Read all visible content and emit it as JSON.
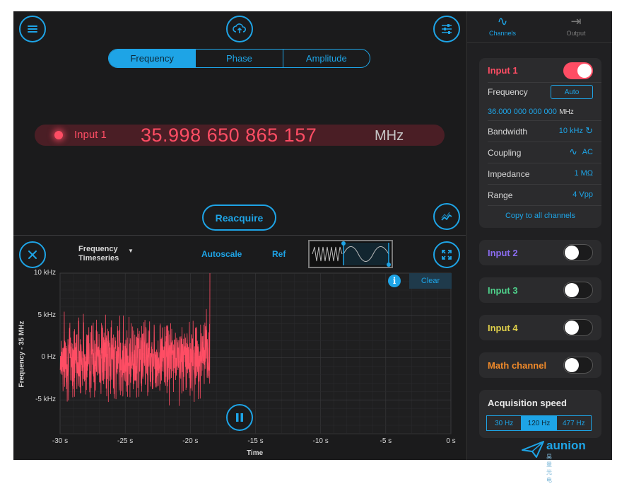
{
  "top": {
    "tabs": [
      {
        "label": "Frequency",
        "active": true
      },
      {
        "label": "Phase",
        "active": false
      },
      {
        "label": "Amplitude",
        "active": false
      }
    ],
    "readout": {
      "channel": "Input 1",
      "value": "35.998 650 865 157",
      "unit": "MHz"
    },
    "reacquire_label": "Reacquire"
  },
  "plot": {
    "mode_line1": "Frequency",
    "mode_line2": "Timeseries",
    "autoscale_label": "Autoscale",
    "ref_label": "Ref",
    "clear_label": "Clear",
    "info_label": "i"
  },
  "chart_data": {
    "type": "line",
    "xlabel": "Time",
    "ylabel": "Frequency - 35 MHz",
    "x_ticks": [
      "-30 s",
      "-25 s",
      "-20 s",
      "-15 s",
      "-10 s",
      "-5 s",
      "0 s"
    ],
    "y_ticks": [
      "10 kHz",
      "5 kHz",
      "0 Hz",
      "-5 kHz"
    ],
    "xlim": [
      -30,
      0
    ],
    "ylim": [
      -9,
      10
    ],
    "x_unit": "s",
    "y_unit": "kHz",
    "series": [
      {
        "color": "#ff4d64",
        "x_range": [
          -30,
          -18.5
        ],
        "mean": 0,
        "spread": 6.5
      }
    ],
    "grid": true
  },
  "sidebar": {
    "tabs": [
      {
        "label": "Channels",
        "icon": "sine-wave-icon",
        "active": true
      },
      {
        "label": "Output",
        "icon": "output-icon",
        "active": false
      }
    ],
    "input1": {
      "label": "Input 1",
      "enabled": true,
      "frequency_label": "Frequency",
      "auto_label": "Auto",
      "frequency_value": "36.000 000 000 000",
      "frequency_unit": "MHz",
      "bandwidth_label": "Bandwidth",
      "bandwidth_value": "10 kHz",
      "coupling_label": "Coupling",
      "coupling_value": "AC",
      "impedance_label": "Impedance",
      "impedance_value": "1 MΩ",
      "range_label": "Range",
      "range_value": "4 Vpp",
      "copy_label": "Copy to all channels"
    },
    "channels": [
      {
        "label": "Input 2",
        "color": "#8a6cf0",
        "enabled": false
      },
      {
        "label": "Input 3",
        "color": "#4fd18b",
        "enabled": false
      },
      {
        "label": "Input 4",
        "color": "#e0d04a",
        "enabled": false
      },
      {
        "label": "Math channel",
        "color": "#f08a2a",
        "enabled": false
      }
    ],
    "acquisition": {
      "title": "Acquisition speed",
      "options": [
        "30 Hz",
        "120 Hz",
        "477 Hz"
      ],
      "selected": "120 Hz"
    }
  },
  "watermark": {
    "name": "aunion",
    "sub": "昊量光电"
  },
  "colors": {
    "accent": "#1ea4e6",
    "input1": "#ff4d64",
    "background": "#1b1b1c"
  }
}
